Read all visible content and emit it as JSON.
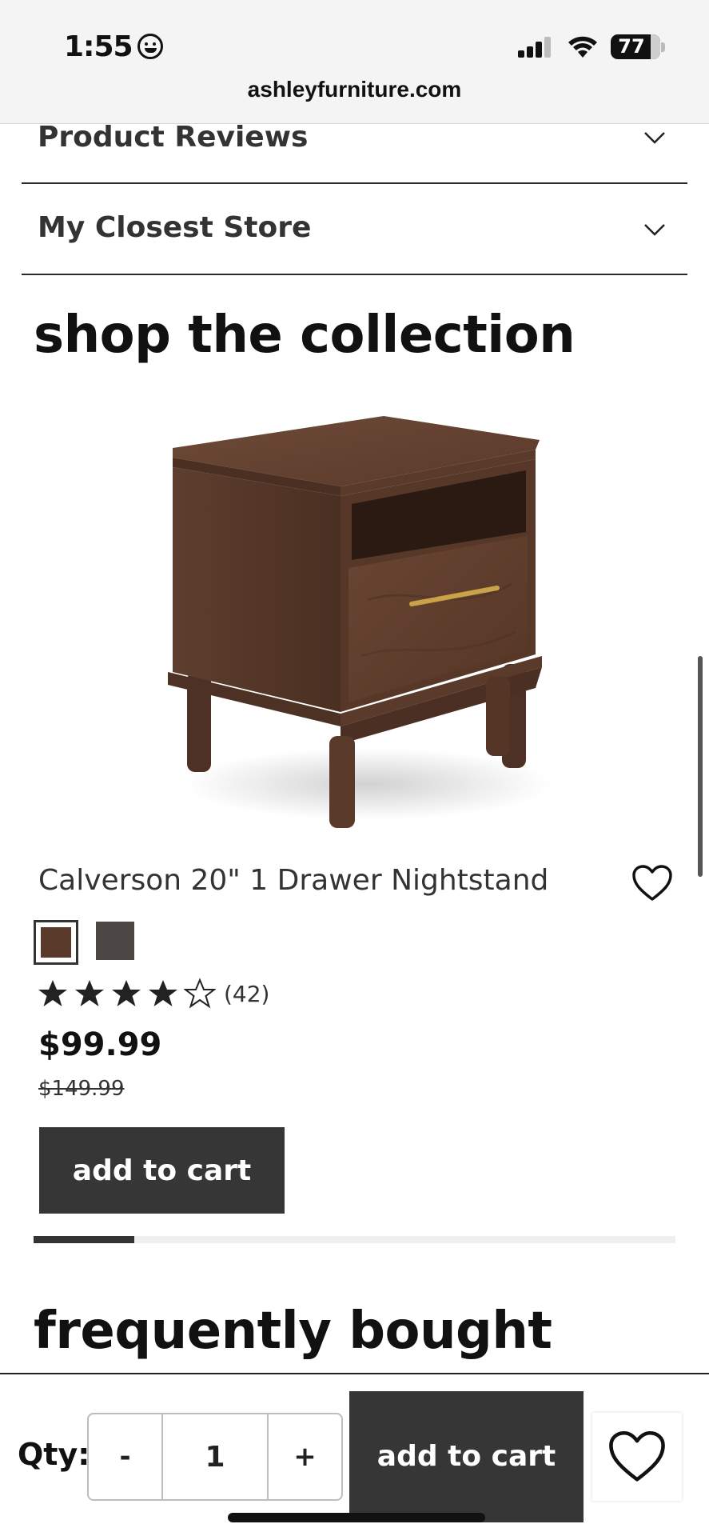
{
  "status_bar": {
    "time": "1:55",
    "battery": "77"
  },
  "browser": {
    "url": "ashleyfurniture.com"
  },
  "accordions": [
    {
      "label": "Product Reviews"
    },
    {
      "label": "My Closest Store"
    }
  ],
  "collection": {
    "title": "shop the collection",
    "product": {
      "name": "Calverson 20\" 1 Drawer Nightstand",
      "swatches": [
        {
          "color": "#5a3a2b",
          "selected": true
        },
        {
          "color": "#4b4644",
          "selected": false
        }
      ],
      "rating": 4,
      "rating_max": 5,
      "review_count": "(42)",
      "price": "$99.99",
      "old_price": "$149.99",
      "add_to_cart_label": "add to cart"
    },
    "carousel_progress": 0.157
  },
  "next_section": {
    "title": "frequently bought"
  },
  "bottom_bar": {
    "qty_label": "Qty:",
    "minus_label": "-",
    "quantity": "1",
    "plus_label": "+",
    "add_to_cart_label": "add to cart"
  },
  "colors": {
    "button_dark": "#363636",
    "wood": "#5a3a2b"
  },
  "icons": {
    "accordion_chevron": "chevron-down-icon",
    "favorite": "heart-outline-icon",
    "rating": "star-icon"
  }
}
